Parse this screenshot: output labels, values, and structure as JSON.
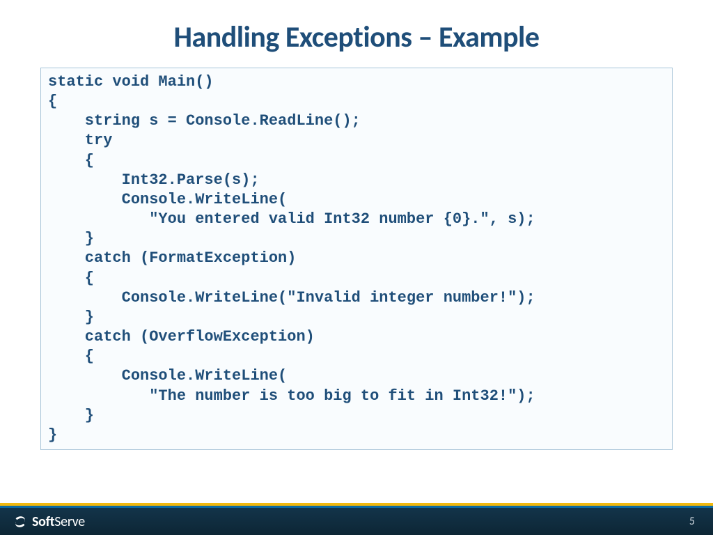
{
  "title": "Handling Exceptions – Example",
  "code": "static void Main()\n{\n    string s = Console.ReadLine();\n    try\n    {\n        Int32.Parse(s);\n        Console.WriteLine(\n           \"You entered valid Int32 number {0}.\", s);\n    }\n    catch (FormatException)\n    {\n        Console.WriteLine(\"Invalid integer number!\");\n    }\n    catch (OverflowException)\n    {\n        Console.WriteLine(\n           \"The number is too big to fit in Int32!\");\n    }\n}",
  "footer": {
    "brand_bold": "Soft",
    "brand_light": "Serve",
    "page": "5"
  }
}
